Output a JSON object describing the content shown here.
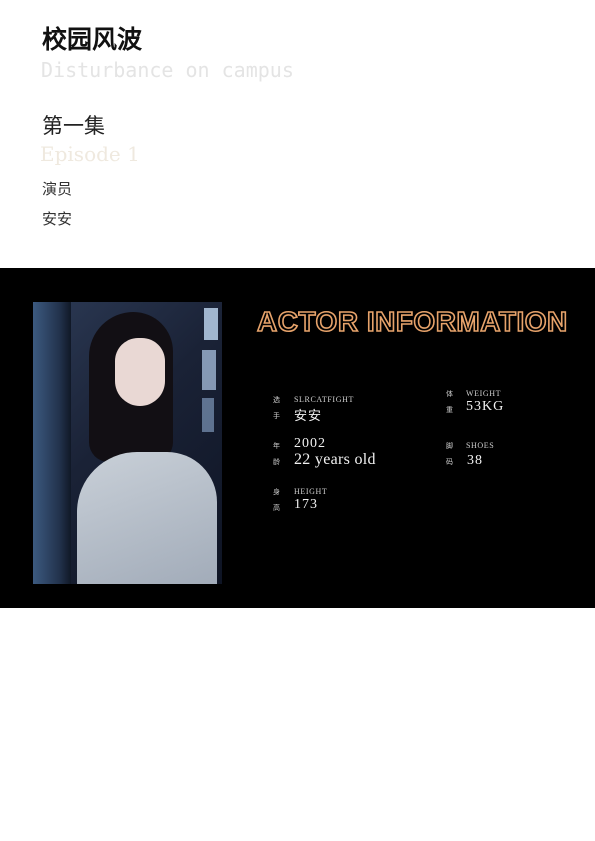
{
  "header": {
    "title_cn": "校园风波",
    "title_en": "Disturbance on campus",
    "episode_cn": "第一集",
    "episode_en": "Episode 1",
    "cast_label": "演员",
    "cast_name": "安安"
  },
  "card": {
    "headline": "ACTOR INFORMATION",
    "accent_color": "#e7a36b",
    "fields": {
      "player": {
        "cn_top": "选",
        "cn_bottom": "手",
        "label": "SLRCATFIGHT",
        "value": "安安"
      },
      "weight": {
        "cn_top": "体",
        "cn_bottom": "重",
        "label": "WEIGHT",
        "value": "53KG"
      },
      "age": {
        "cn_top": "年",
        "cn_bottom": "龄",
        "label": "",
        "value_line1": "2002",
        "value_line2": "22 years old"
      },
      "shoes": {
        "cn_top": "脚",
        "cn_bottom": "码",
        "label": "SHOES",
        "value": "38"
      },
      "height": {
        "cn_top": "身",
        "cn_bottom": "高",
        "label": "HEIGHT",
        "value": "173"
      }
    }
  }
}
